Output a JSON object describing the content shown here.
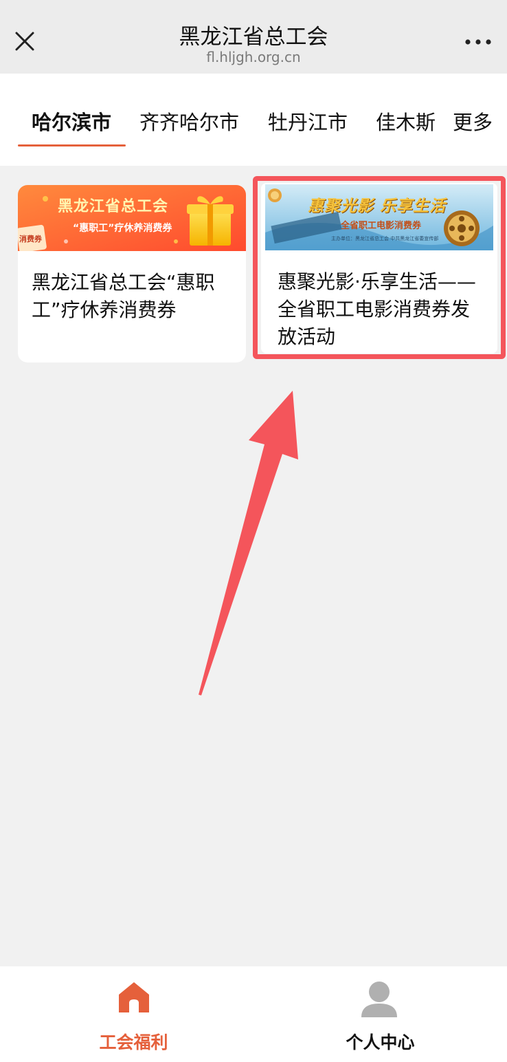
{
  "header": {
    "title": "黑龙江省总工会",
    "url": "fl.hljgh.org.cn"
  },
  "tabs": [
    {
      "label": "哈尔滨市",
      "active": true
    },
    {
      "label": "齐齐哈尔市",
      "active": false
    },
    {
      "label": "牡丹江市",
      "active": false
    },
    {
      "label": "佳木斯",
      "active": false
    }
  ],
  "tabs_more": "更多",
  "cards": [
    {
      "banner_title": "黑龙江省总工会",
      "banner_sub": "“惠职工”疗休养消费券",
      "banner_tag": "消费券",
      "title": "黑龙江省总工会“惠职工”疗休养消费券"
    },
    {
      "banner_title": "惠聚光影 乐享生活",
      "banner_sub": "全省职工电影消费券",
      "banner_note": "主办单位：黑龙江省总工会  中共黑龙江省委宣传部",
      "title": "惠聚光影·乐享生活——全省职工电影消费券发放活动"
    }
  ],
  "bottom_nav": {
    "home_label": "工会福利",
    "profile_label": "个人中心"
  },
  "colors": {
    "accent": "#e5603b",
    "highlight": "#f4555b"
  }
}
